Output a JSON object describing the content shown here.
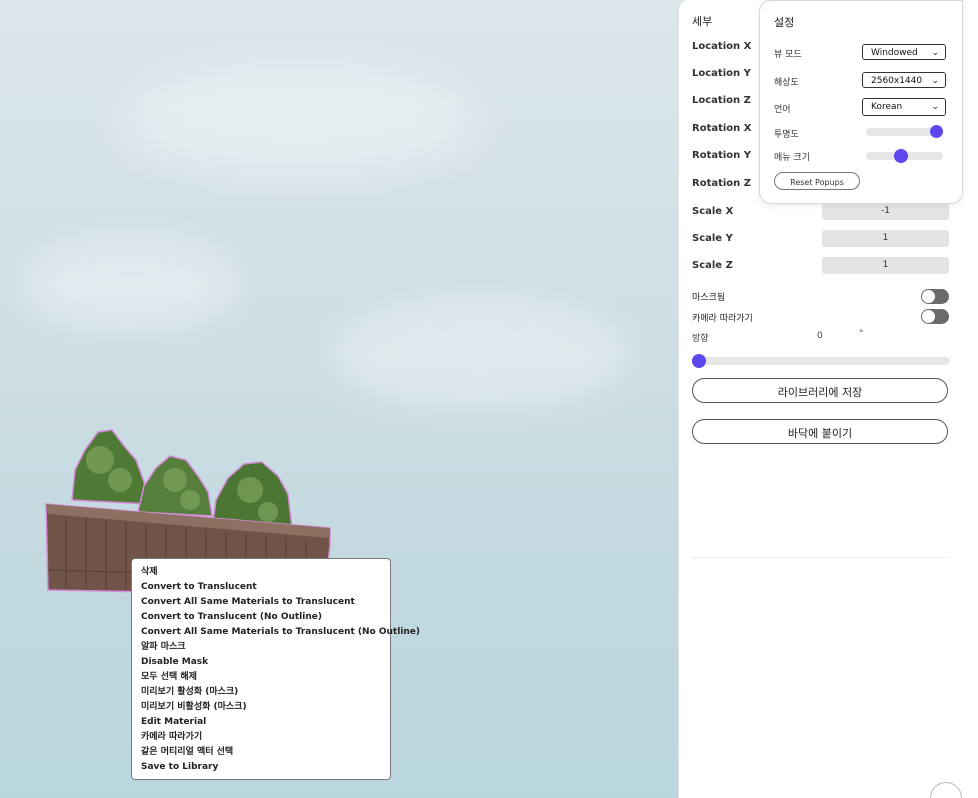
{
  "details": {
    "title": "세부",
    "fields": [
      {
        "label": "Location X",
        "value": ""
      },
      {
        "label": "Location Y",
        "value": ""
      },
      {
        "label": "Location Z",
        "value": ""
      },
      {
        "label": "Rotation X",
        "value": ""
      },
      {
        "label": "Rotation Y",
        "value": ""
      },
      {
        "label": "Rotation Z",
        "value": ""
      },
      {
        "label": "Scale X",
        "value": "-1"
      },
      {
        "label": "Scale Y",
        "value": "1"
      },
      {
        "label": "Scale Z",
        "value": "1"
      }
    ],
    "masked_label": "마스크됨",
    "camera_follow_label": "카메라 따라가기",
    "direction_label": "방향",
    "direction_value": "0",
    "direction_unit": "°",
    "direction_slider_value": 0,
    "save_library_label": "라이브러리에 저장",
    "snap_floor_label": "바닥에 붙이기"
  },
  "settings": {
    "title": "설정",
    "view_mode_label": "뷰 모드",
    "view_mode_value": "Windowed",
    "resolution_label": "해상도",
    "resolution_value": "2560x1440",
    "language_label": "언어",
    "language_value": "Korean",
    "transparency_label": "투명도",
    "transparency_value": 1.0,
    "menu_size_label": "메뉴 크기",
    "menu_size_value": 0.45,
    "reset_label": "Reset Popups"
  },
  "context_menu": {
    "items": [
      "삭제",
      "Convert to Translucent",
      "Convert All Same Materials to Translucent",
      "Convert to Translucent (No Outline)",
      "Convert All Same Materials to Translucent (No Outline)",
      "알파 마스크",
      "Disable Mask",
      "모두 선택 해제",
      "미리보기 활성화 (마스크)",
      "미리보기 비활성화 (마스크)",
      "Edit Material",
      "카메라 따라가기",
      "같은 머티리얼 액터 선택",
      "Save to Library"
    ]
  },
  "colors": {
    "accent": "#5d48f0",
    "toggle_off": "#6b6b6b"
  }
}
